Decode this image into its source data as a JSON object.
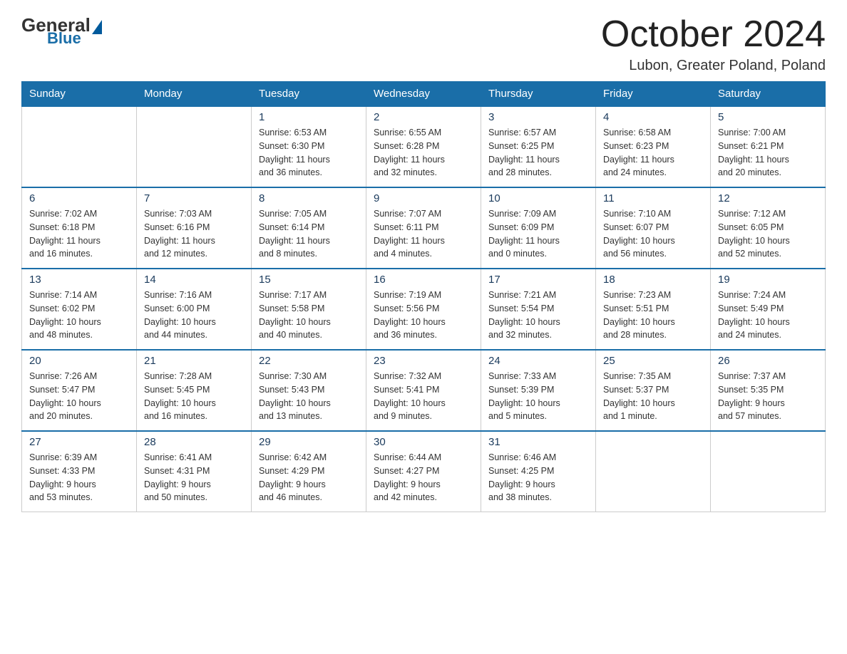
{
  "header": {
    "logo": {
      "general": "General",
      "blue": "Blue",
      "triangle": "▶"
    },
    "title": "October 2024",
    "location": "Lubon, Greater Poland, Poland"
  },
  "weekdays": [
    "Sunday",
    "Monday",
    "Tuesday",
    "Wednesday",
    "Thursday",
    "Friday",
    "Saturday"
  ],
  "weeks": [
    [
      {
        "day": "",
        "info": ""
      },
      {
        "day": "",
        "info": ""
      },
      {
        "day": "1",
        "info": "Sunrise: 6:53 AM\nSunset: 6:30 PM\nDaylight: 11 hours\nand 36 minutes."
      },
      {
        "day": "2",
        "info": "Sunrise: 6:55 AM\nSunset: 6:28 PM\nDaylight: 11 hours\nand 32 minutes."
      },
      {
        "day": "3",
        "info": "Sunrise: 6:57 AM\nSunset: 6:25 PM\nDaylight: 11 hours\nand 28 minutes."
      },
      {
        "day": "4",
        "info": "Sunrise: 6:58 AM\nSunset: 6:23 PM\nDaylight: 11 hours\nand 24 minutes."
      },
      {
        "day": "5",
        "info": "Sunrise: 7:00 AM\nSunset: 6:21 PM\nDaylight: 11 hours\nand 20 minutes."
      }
    ],
    [
      {
        "day": "6",
        "info": "Sunrise: 7:02 AM\nSunset: 6:18 PM\nDaylight: 11 hours\nand 16 minutes."
      },
      {
        "day": "7",
        "info": "Sunrise: 7:03 AM\nSunset: 6:16 PM\nDaylight: 11 hours\nand 12 minutes."
      },
      {
        "day": "8",
        "info": "Sunrise: 7:05 AM\nSunset: 6:14 PM\nDaylight: 11 hours\nand 8 minutes."
      },
      {
        "day": "9",
        "info": "Sunrise: 7:07 AM\nSunset: 6:11 PM\nDaylight: 11 hours\nand 4 minutes."
      },
      {
        "day": "10",
        "info": "Sunrise: 7:09 AM\nSunset: 6:09 PM\nDaylight: 11 hours\nand 0 minutes."
      },
      {
        "day": "11",
        "info": "Sunrise: 7:10 AM\nSunset: 6:07 PM\nDaylight: 10 hours\nand 56 minutes."
      },
      {
        "day": "12",
        "info": "Sunrise: 7:12 AM\nSunset: 6:05 PM\nDaylight: 10 hours\nand 52 minutes."
      }
    ],
    [
      {
        "day": "13",
        "info": "Sunrise: 7:14 AM\nSunset: 6:02 PM\nDaylight: 10 hours\nand 48 minutes."
      },
      {
        "day": "14",
        "info": "Sunrise: 7:16 AM\nSunset: 6:00 PM\nDaylight: 10 hours\nand 44 minutes."
      },
      {
        "day": "15",
        "info": "Sunrise: 7:17 AM\nSunset: 5:58 PM\nDaylight: 10 hours\nand 40 minutes."
      },
      {
        "day": "16",
        "info": "Sunrise: 7:19 AM\nSunset: 5:56 PM\nDaylight: 10 hours\nand 36 minutes."
      },
      {
        "day": "17",
        "info": "Sunrise: 7:21 AM\nSunset: 5:54 PM\nDaylight: 10 hours\nand 32 minutes."
      },
      {
        "day": "18",
        "info": "Sunrise: 7:23 AM\nSunset: 5:51 PM\nDaylight: 10 hours\nand 28 minutes."
      },
      {
        "day": "19",
        "info": "Sunrise: 7:24 AM\nSunset: 5:49 PM\nDaylight: 10 hours\nand 24 minutes."
      }
    ],
    [
      {
        "day": "20",
        "info": "Sunrise: 7:26 AM\nSunset: 5:47 PM\nDaylight: 10 hours\nand 20 minutes."
      },
      {
        "day": "21",
        "info": "Sunrise: 7:28 AM\nSunset: 5:45 PM\nDaylight: 10 hours\nand 16 minutes."
      },
      {
        "day": "22",
        "info": "Sunrise: 7:30 AM\nSunset: 5:43 PM\nDaylight: 10 hours\nand 13 minutes."
      },
      {
        "day": "23",
        "info": "Sunrise: 7:32 AM\nSunset: 5:41 PM\nDaylight: 10 hours\nand 9 minutes."
      },
      {
        "day": "24",
        "info": "Sunrise: 7:33 AM\nSunset: 5:39 PM\nDaylight: 10 hours\nand 5 minutes."
      },
      {
        "day": "25",
        "info": "Sunrise: 7:35 AM\nSunset: 5:37 PM\nDaylight: 10 hours\nand 1 minute."
      },
      {
        "day": "26",
        "info": "Sunrise: 7:37 AM\nSunset: 5:35 PM\nDaylight: 9 hours\nand 57 minutes."
      }
    ],
    [
      {
        "day": "27",
        "info": "Sunrise: 6:39 AM\nSunset: 4:33 PM\nDaylight: 9 hours\nand 53 minutes."
      },
      {
        "day": "28",
        "info": "Sunrise: 6:41 AM\nSunset: 4:31 PM\nDaylight: 9 hours\nand 50 minutes."
      },
      {
        "day": "29",
        "info": "Sunrise: 6:42 AM\nSunset: 4:29 PM\nDaylight: 9 hours\nand 46 minutes."
      },
      {
        "day": "30",
        "info": "Sunrise: 6:44 AM\nSunset: 4:27 PM\nDaylight: 9 hours\nand 42 minutes."
      },
      {
        "day": "31",
        "info": "Sunrise: 6:46 AM\nSunset: 4:25 PM\nDaylight: 9 hours\nand 38 minutes."
      },
      {
        "day": "",
        "info": ""
      },
      {
        "day": "",
        "info": ""
      }
    ]
  ]
}
